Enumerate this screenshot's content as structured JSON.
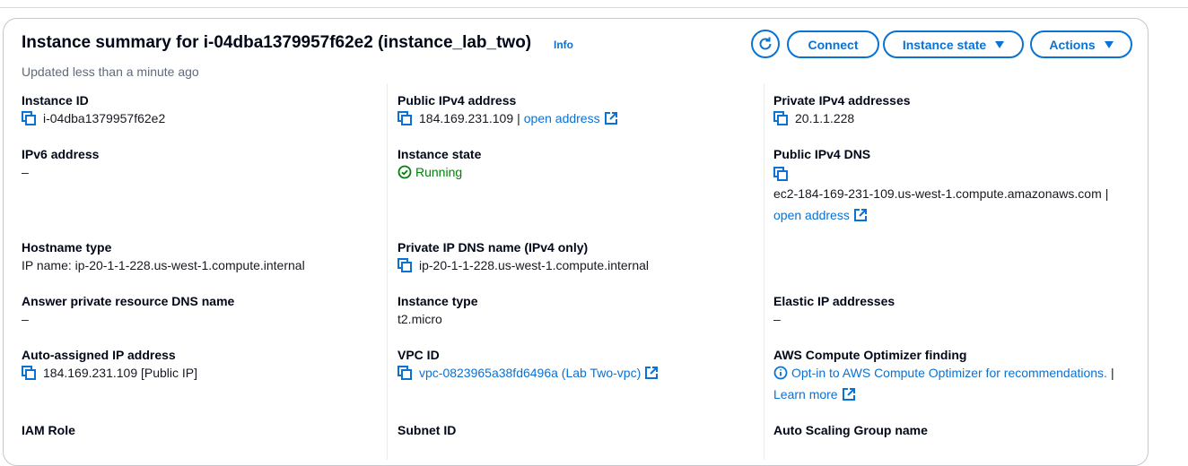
{
  "header": {
    "title": "Instance summary for i-04dba1379957f62e2 (instance_lab_two)",
    "info": "Info",
    "updated": "Updated less than a minute ago",
    "buttons": {
      "connect": "Connect",
      "instance_state": "Instance state",
      "actions": "Actions"
    }
  },
  "colors": {
    "link": "#0972d3",
    "running": "#037f0c",
    "text": "#16191f"
  },
  "fields": {
    "instance_id": {
      "label": "Instance ID",
      "value": "i-04dba1379957f62e2"
    },
    "public_ipv4": {
      "label": "Public IPv4 address",
      "value": "184.169.231.109",
      "sep": "|",
      "link": "open address"
    },
    "private_ipv4": {
      "label": "Private IPv4 addresses",
      "value": "20.1.1.228"
    },
    "ipv6": {
      "label": "IPv6 address",
      "value": "–"
    },
    "instance_state": {
      "label": "Instance state",
      "value": "Running"
    },
    "public_dns": {
      "label": "Public IPv4 DNS",
      "value": "ec2-184-169-231-109.us-west-1.compute.amazonaws.com",
      "sep": "|",
      "link": "open address"
    },
    "hostname_type": {
      "label": "Hostname type",
      "value": "IP name: ip-20-1-1-228.us-west-1.compute.internal"
    },
    "private_dns": {
      "label": "Private IP DNS name (IPv4 only)",
      "value": "ip-20-1-1-228.us-west-1.compute.internal"
    },
    "answer_dns": {
      "label": "Answer private resource DNS name",
      "value": "–"
    },
    "instance_type": {
      "label": "Instance type",
      "value": "t2.micro"
    },
    "elastic_ip": {
      "label": "Elastic IP addresses",
      "value": "–"
    },
    "auto_ip": {
      "label": "Auto-assigned IP address",
      "value": "184.169.231.109 [Public IP]"
    },
    "vpc_id": {
      "label": "VPC ID",
      "value": "vpc-0823965a38fd6496a (Lab Two-vpc)"
    },
    "optimizer": {
      "label": "AWS Compute Optimizer finding",
      "value": "Opt-in to AWS Compute Optimizer for recommendations.",
      "sep": "|",
      "link": "Learn more"
    },
    "iam_role": {
      "label": "IAM Role"
    },
    "subnet_id": {
      "label": "Subnet ID"
    },
    "asg_name": {
      "label": "Auto Scaling Group name"
    }
  }
}
